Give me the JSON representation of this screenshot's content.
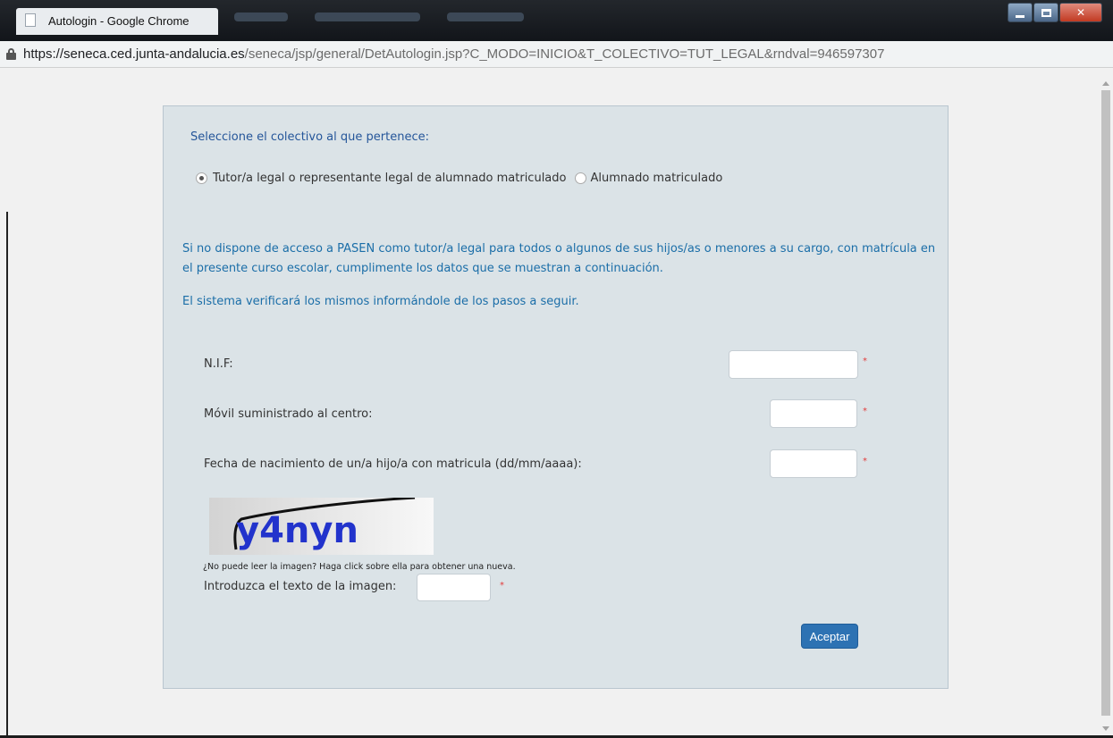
{
  "window": {
    "title": "Autologin - Google Chrome"
  },
  "address": {
    "url_host": "https://seneca.ced.junta-andalucia.es",
    "url_path": "/seneca/jsp/general/DetAutologin.jsp?C_MODO=INICIO&T_COLECTIVO=TUT_LEGAL&rndval=946597307"
  },
  "form": {
    "prompt": "Seleccione el colectivo al que pertenece:",
    "radio_options": [
      {
        "label": "Tutor/a legal o representante legal de alumnado matriculado",
        "checked": true
      },
      {
        "label": "Alumnado matriculado",
        "checked": false
      }
    ],
    "info_text_1": "Si no dispone de acceso a PASEN como tutor/a legal para todos o algunos de sus hijos/as o menores a su cargo, con matrícula en el presente curso escolar, cumplimente los datos que se muestran a continuación.",
    "info_text_2": "El sistema verificará los mismos informándole de los pasos a seguir.",
    "fields": {
      "nif_label": "N.I.F:",
      "movil_label": "Móvil suministrado al centro:",
      "fecha_label": "Fecha de nacimiento de un/a hijo/a con matricula (dd/mm/aaaa):"
    },
    "required_marker": "*",
    "captcha_text": "y4nyn",
    "captcha_hint": "¿No puede leer la imagen? Haga click sobre ella para obtener una nueva.",
    "captcha_label": "Introduzca el texto de la imagen:",
    "submit_label": "Aceptar"
  },
  "colors": {
    "prompt_blue": "#25569a",
    "info_blue": "#1b6ea8",
    "button_blue": "#2d72b3",
    "panel_bg": "#dbe3e7",
    "required_red": "#e23b3b"
  }
}
